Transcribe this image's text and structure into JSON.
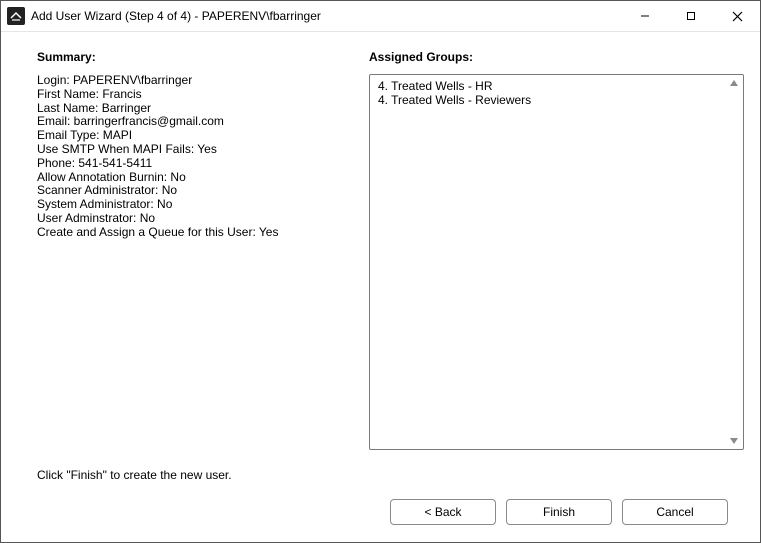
{
  "window": {
    "title": "Add User Wizard (Step 4 of 4) - PAPERENV\\fbarringer"
  },
  "summary": {
    "header": "Summary:",
    "lines": [
      "Login: PAPERENV\\fbarringer",
      "First Name: Francis",
      "Last Name: Barringer",
      "Email: barringerfrancis@gmail.com",
      "Email Type: MAPI",
      "Use SMTP When MAPI Fails: Yes",
      "Phone: 541-541-5411",
      "Allow Annotation Burnin: No",
      "Scanner Administrator: No",
      "System Administrator: No",
      "User Adminstrator: No",
      "Create and Assign a Queue for this User: Yes"
    ]
  },
  "groups": {
    "header": "Assigned Groups:",
    "items": [
      "4. Treated Wells - HR",
      "4. Treated Wells - Reviewers"
    ]
  },
  "hint": "Click \"Finish\" to create the new user.",
  "buttons": {
    "back": "< Back",
    "finish": "Finish",
    "cancel": "Cancel"
  }
}
